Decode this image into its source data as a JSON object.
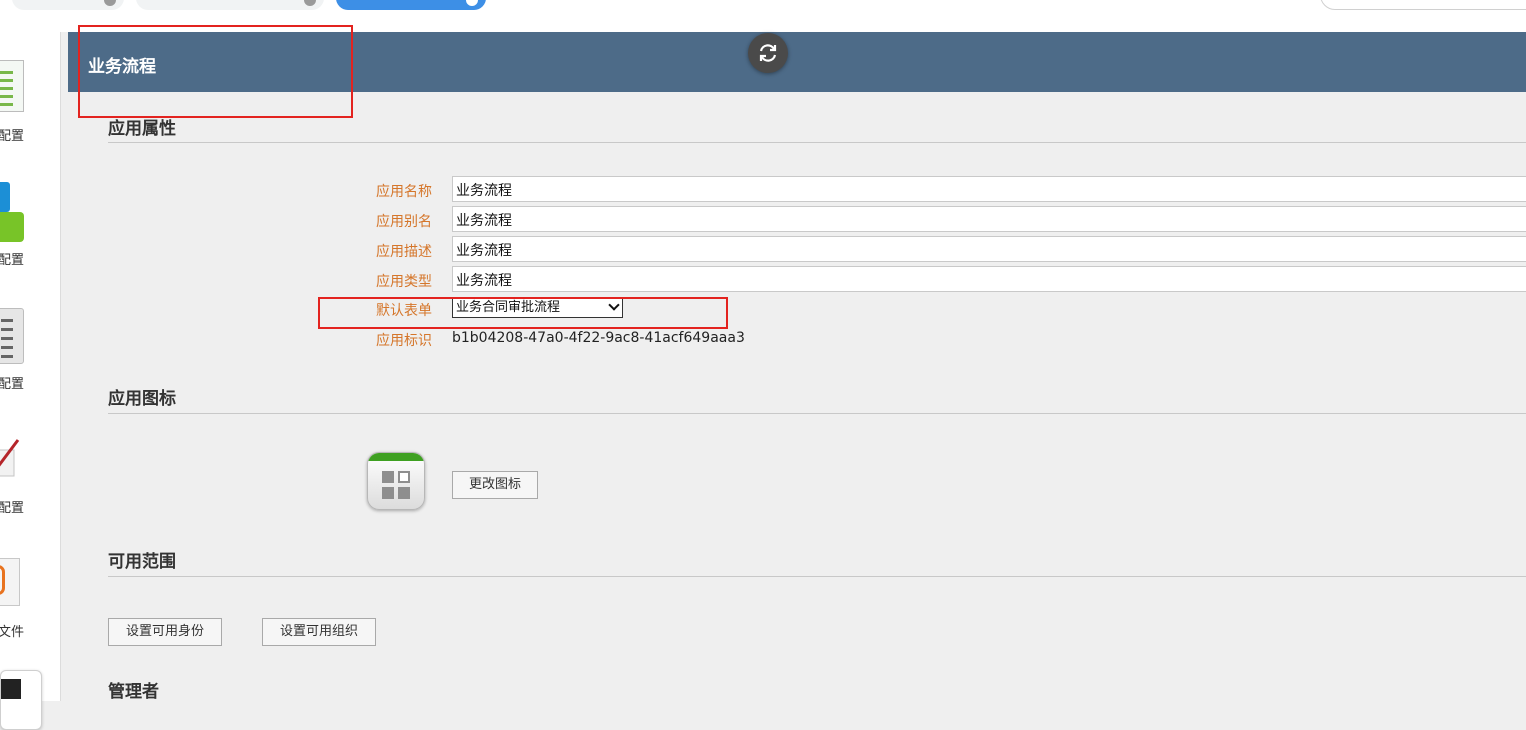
{
  "header": {
    "title": "业务流程"
  },
  "sidebar": {
    "items": [
      {
        "label": "配置",
        "icon": "document-icon"
      },
      {
        "label": "配置",
        "icon": "blocks-icon"
      },
      {
        "label": "配置",
        "icon": "list-icon"
      },
      {
        "label": "配置",
        "icon": "pen-icon"
      },
      {
        "label": "文件",
        "icon": "paperclip-icon"
      }
    ]
  },
  "sections": {
    "properties": "应用属性",
    "icon": "应用图标",
    "scope": "可用范围",
    "admins": "管理者"
  },
  "fields": {
    "name": {
      "label": "应用名称",
      "value": "业务流程"
    },
    "alias": {
      "label": "应用别名",
      "value": "业务流程"
    },
    "description": {
      "label": "应用描述",
      "value": "业务流程"
    },
    "type": {
      "label": "应用类型",
      "value": "业务流程"
    },
    "default_form": {
      "label": "默认表单",
      "value": "业务合同审批流程"
    },
    "identifier": {
      "label": "应用标识",
      "value": "b1b04208-47a0-4f22-9ac8-41acf649aaa3"
    }
  },
  "buttons": {
    "change_icon": "更改图标",
    "set_identity": "设置可用身份",
    "set_org": "设置可用组织"
  },
  "colors": {
    "header_bg": "#4d6b88",
    "label_orange": "#d5762a",
    "highlight_red": "#e3231f"
  }
}
